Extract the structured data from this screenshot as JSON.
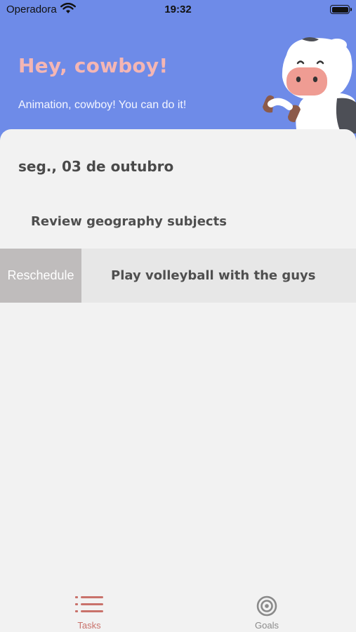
{
  "status_bar": {
    "carrier": "Operadora",
    "time": "19:32",
    "wifi_icon": "wifi-icon",
    "battery_icon": "battery-icon"
  },
  "header": {
    "greeting": "Hey, cowboy!",
    "subtitle": "Animation, cowboy! You can do it!",
    "mascot": "cow-illustration",
    "colors": {
      "background": "#6e8be8",
      "greeting": "#f4b6b4"
    }
  },
  "content": {
    "date": "seg., 03 de outubro",
    "tasks": [
      {
        "label": "Review geography subjects"
      },
      {
        "label": "Play volleyball with the guys",
        "swipe_action": "Reschedule"
      }
    ]
  },
  "tab_bar": {
    "tabs": [
      {
        "label": "Tasks",
        "icon": "list-icon",
        "active": true,
        "color": "#c9726b"
      },
      {
        "label": "Goals",
        "icon": "target-icon",
        "active": false,
        "color": "#8a8a8a"
      }
    ]
  }
}
